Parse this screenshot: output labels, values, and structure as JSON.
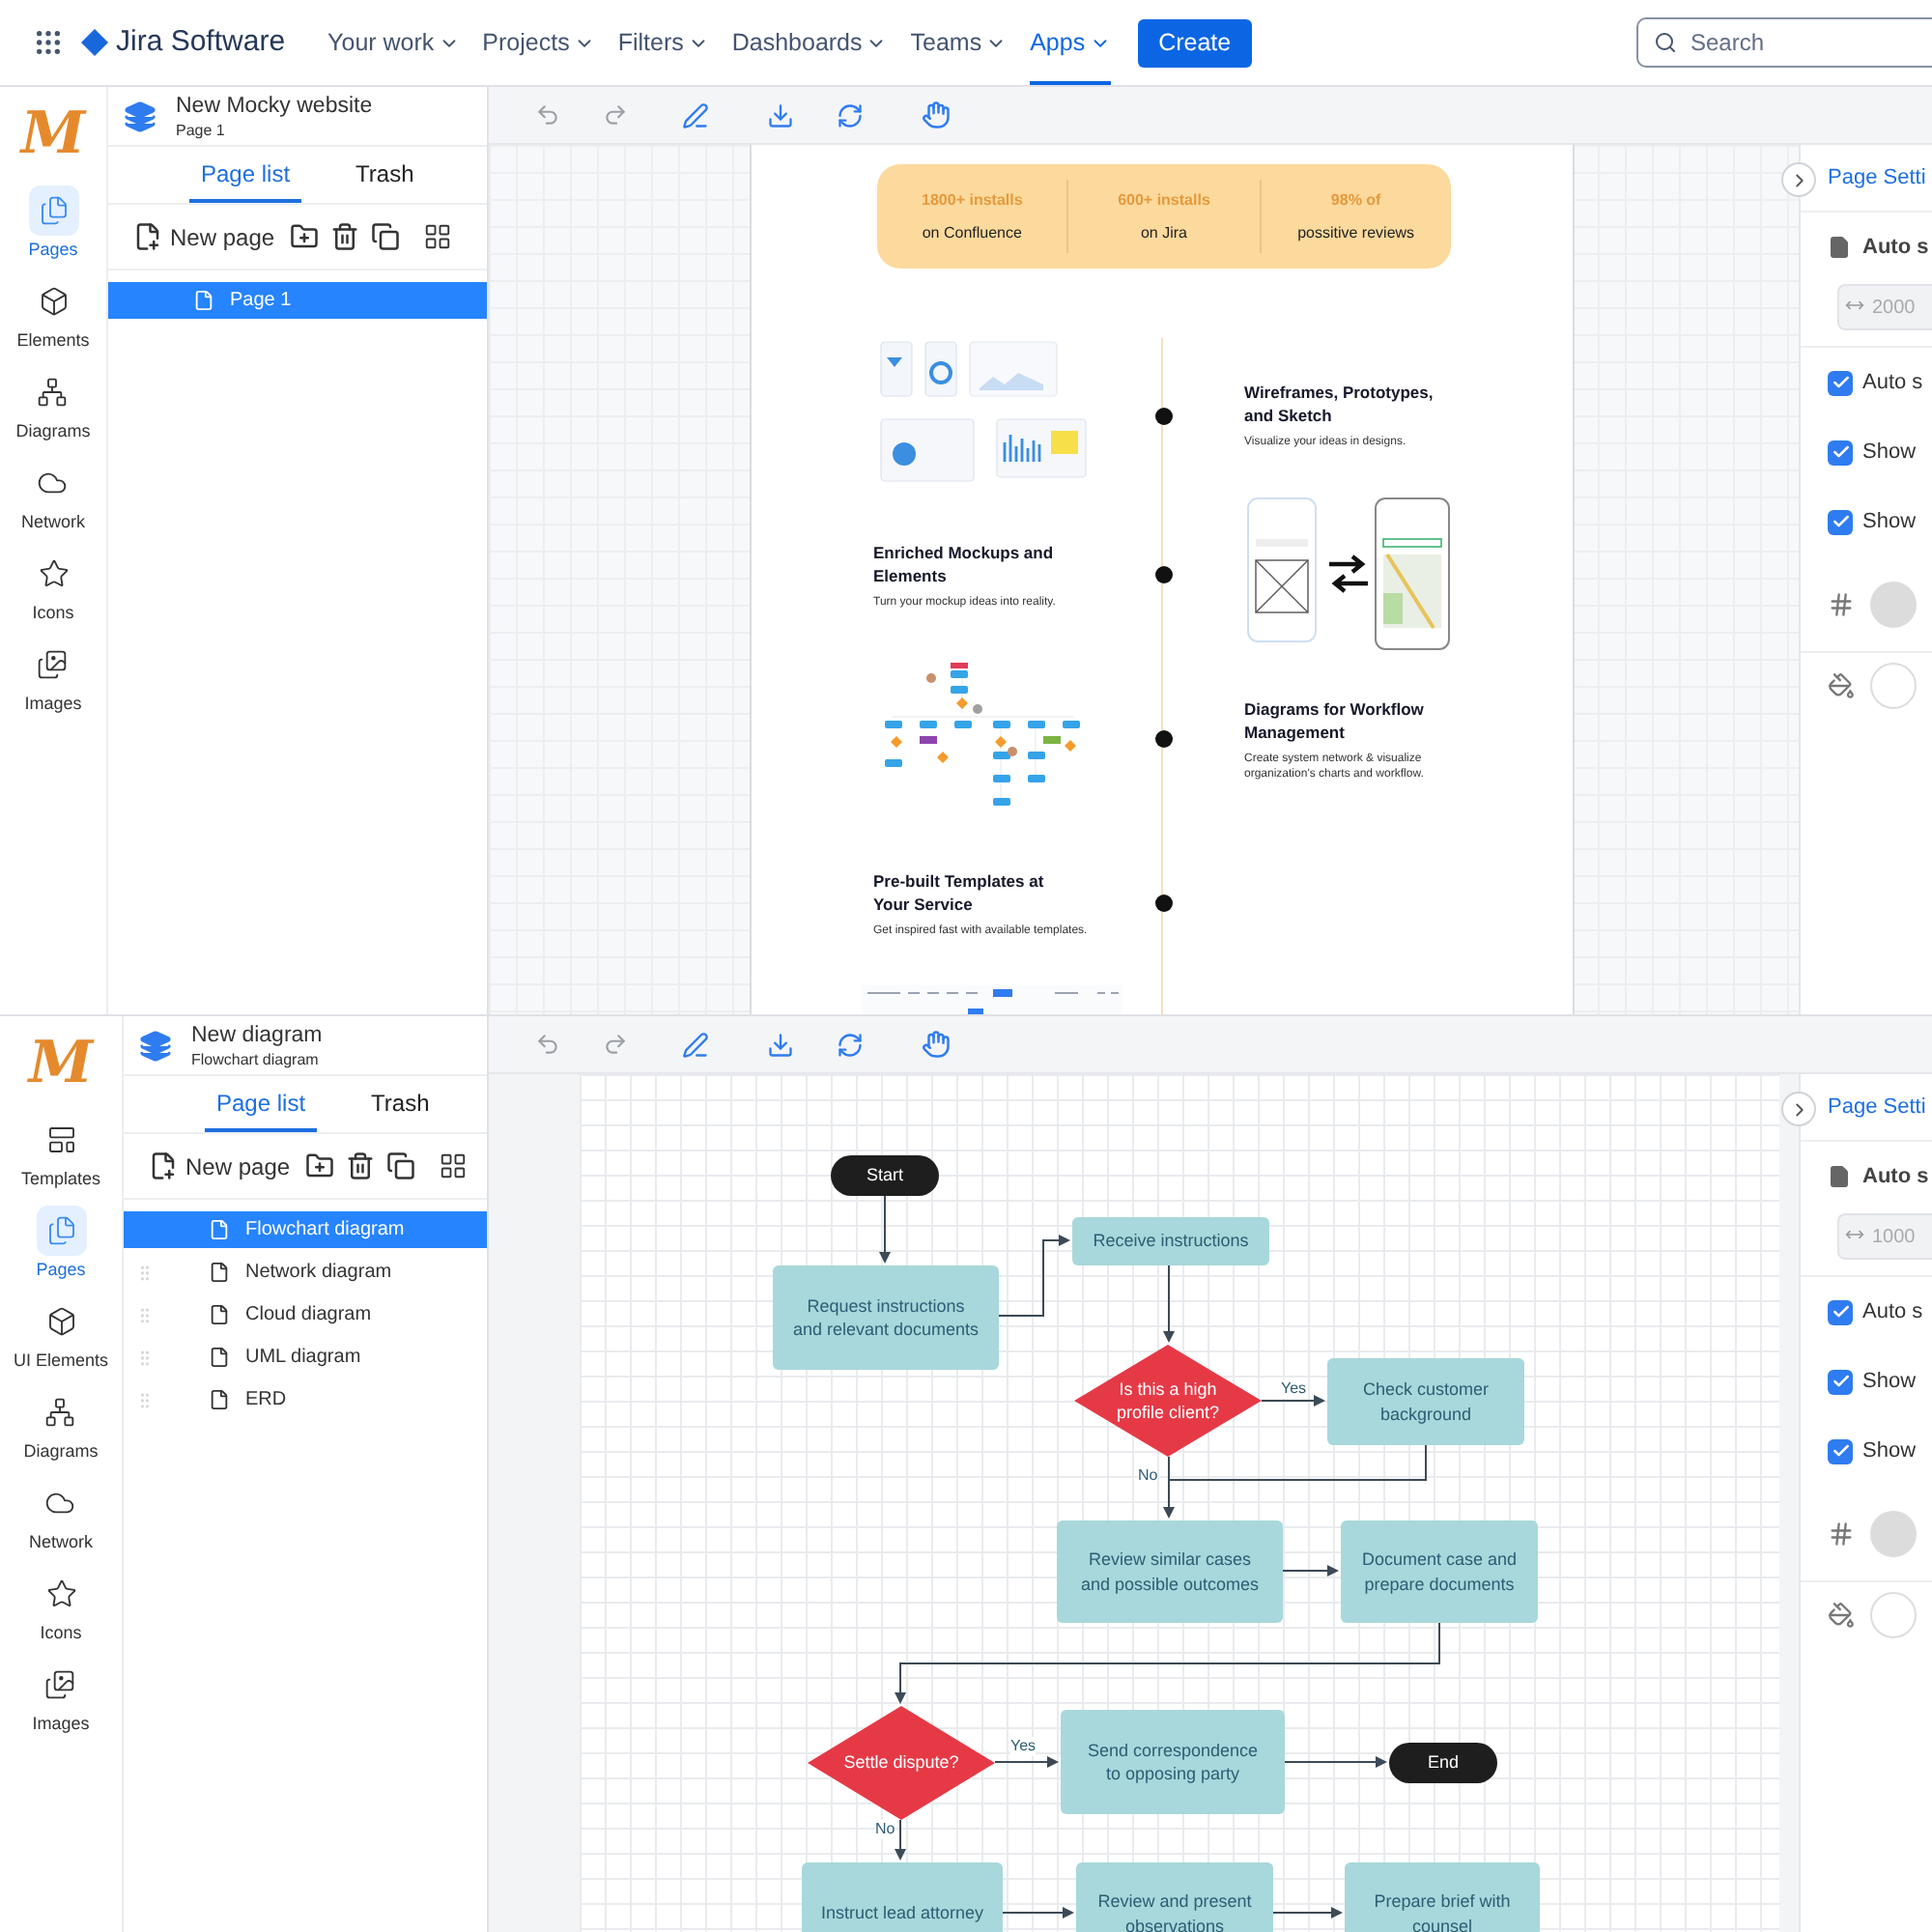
{
  "top_nav": {
    "product": "Jira Software",
    "menus": [
      {
        "label": "Your work",
        "selected": false
      },
      {
        "label": "Projects",
        "selected": false
      },
      {
        "label": "Filters",
        "selected": false
      },
      {
        "label": "Dashboards",
        "selected": false
      },
      {
        "label": "Teams",
        "selected": false
      },
      {
        "label": "Apps",
        "selected": true
      }
    ],
    "create_button": "Create",
    "search": {
      "placeholder": "Search"
    }
  },
  "panes": [
    {
      "logo": "M",
      "rail": [
        {
          "kind": "pages",
          "label": "Pages",
          "selected": true
        },
        {
          "kind": "elements",
          "label": "Elements",
          "selected": false
        },
        {
          "kind": "diagrams",
          "label": "Diagrams",
          "selected": false
        },
        {
          "kind": "network",
          "label": "Network",
          "selected": false
        },
        {
          "kind": "icons",
          "label": "Icons",
          "selected": false
        },
        {
          "kind": "images",
          "label": "Images",
          "selected": false
        }
      ],
      "project": {
        "title": "New Mocky website",
        "subtitle": "Page 1"
      },
      "tabs": [
        {
          "label": "Page list",
          "selected": true
        },
        {
          "label": "Trash",
          "selected": false
        }
      ],
      "new_page": "New page",
      "pages": [
        {
          "label": "Page 1",
          "selected": true
        }
      ],
      "canvas": {
        "kind": "webpage",
        "stats": [
          {
            "value": "1800+ installs",
            "caption": "on Confluence"
          },
          {
            "value": "600+ installs",
            "caption": "on Jira"
          },
          {
            "value": "98% of",
            "caption": "possitive reviews"
          }
        ],
        "sections": [
          {
            "kind": "text_right",
            "title": "Wireframes, Prototypes, and Sketch",
            "text": "Visualize your ideas in designs."
          },
          {
            "kind": "text_left",
            "title": "Enriched Mockups and Elements",
            "text": "Turn your mockup ideas into reality."
          },
          {
            "kind": "text_right",
            "title": "Diagrams for Workflow Management",
            "text": "Create system network & visualize organization's charts and workflow."
          },
          {
            "kind": "text_left",
            "title": "Pre-built Templates at Your Service",
            "text": "Get inspired fast with available templates."
          }
        ]
      },
      "page_settings": {
        "title": "Page Setti",
        "size_label": "Auto s",
        "size_value": "2000",
        "options": [
          {
            "label": "Auto s",
            "checked": true
          },
          {
            "label": "Show",
            "checked": true
          },
          {
            "label": "Show",
            "checked": true
          }
        ]
      }
    },
    {
      "logo": "M",
      "rail": [
        {
          "kind": "templates",
          "label": "Templates",
          "selected": false
        },
        {
          "kind": "pages",
          "label": "Pages",
          "selected": true
        },
        {
          "kind": "elements",
          "label": "UI Elements",
          "selected": false
        },
        {
          "kind": "diagrams",
          "label": "Diagrams",
          "selected": false
        },
        {
          "kind": "network",
          "label": "Network",
          "selected": false
        },
        {
          "kind": "icons",
          "label": "Icons",
          "selected": false
        },
        {
          "kind": "images",
          "label": "Images",
          "selected": false
        }
      ],
      "project": {
        "title": "New diagram",
        "subtitle": "Flowchart diagram"
      },
      "tabs": [
        {
          "label": "Page list",
          "selected": true
        },
        {
          "label": "Trash",
          "selected": false
        }
      ],
      "new_page": "New page",
      "pages": [
        {
          "label": "Flowchart diagram",
          "selected": true
        },
        {
          "label": "Network diagram",
          "selected": false
        },
        {
          "label": "Cloud diagram",
          "selected": false
        },
        {
          "label": "UML diagram",
          "selected": false
        },
        {
          "label": "ERD",
          "selected": false
        }
      ],
      "canvas": {
        "kind": "flowchart",
        "nodes": [
          {
            "kind": "terminal",
            "text": "Start"
          },
          {
            "kind": "process",
            "text": "Request instructions and relevant documents"
          },
          {
            "kind": "process",
            "text": "Receive instructions"
          },
          {
            "kind": "decision",
            "text": "Is this a high profile client?"
          },
          {
            "kind": "process",
            "text": "Check customer background"
          },
          {
            "kind": "process",
            "text": "Review similar cases and possible outcomes"
          },
          {
            "kind": "process",
            "text": "Document case and prepare documents"
          },
          {
            "kind": "decision",
            "text": "Settle dispute?"
          },
          {
            "kind": "process",
            "text": "Send correspondence to opposing party"
          },
          {
            "kind": "terminal",
            "text": "End"
          },
          {
            "kind": "process",
            "text": "Instruct lead attorney"
          },
          {
            "kind": "process",
            "text": "Review and present observations"
          },
          {
            "kind": "process",
            "text": "Prepare brief with counsel"
          }
        ],
        "edge_labels": [
          "Yes",
          "No",
          "Yes",
          "No"
        ]
      },
      "page_settings": {
        "title": "Page Setti",
        "size_label": "Auto s",
        "size_value": "1000",
        "options": [
          {
            "label": "Auto s",
            "checked": true
          },
          {
            "label": "Show",
            "checked": true
          },
          {
            "label": "Show",
            "checked": true
          }
        ]
      }
    }
  ]
}
